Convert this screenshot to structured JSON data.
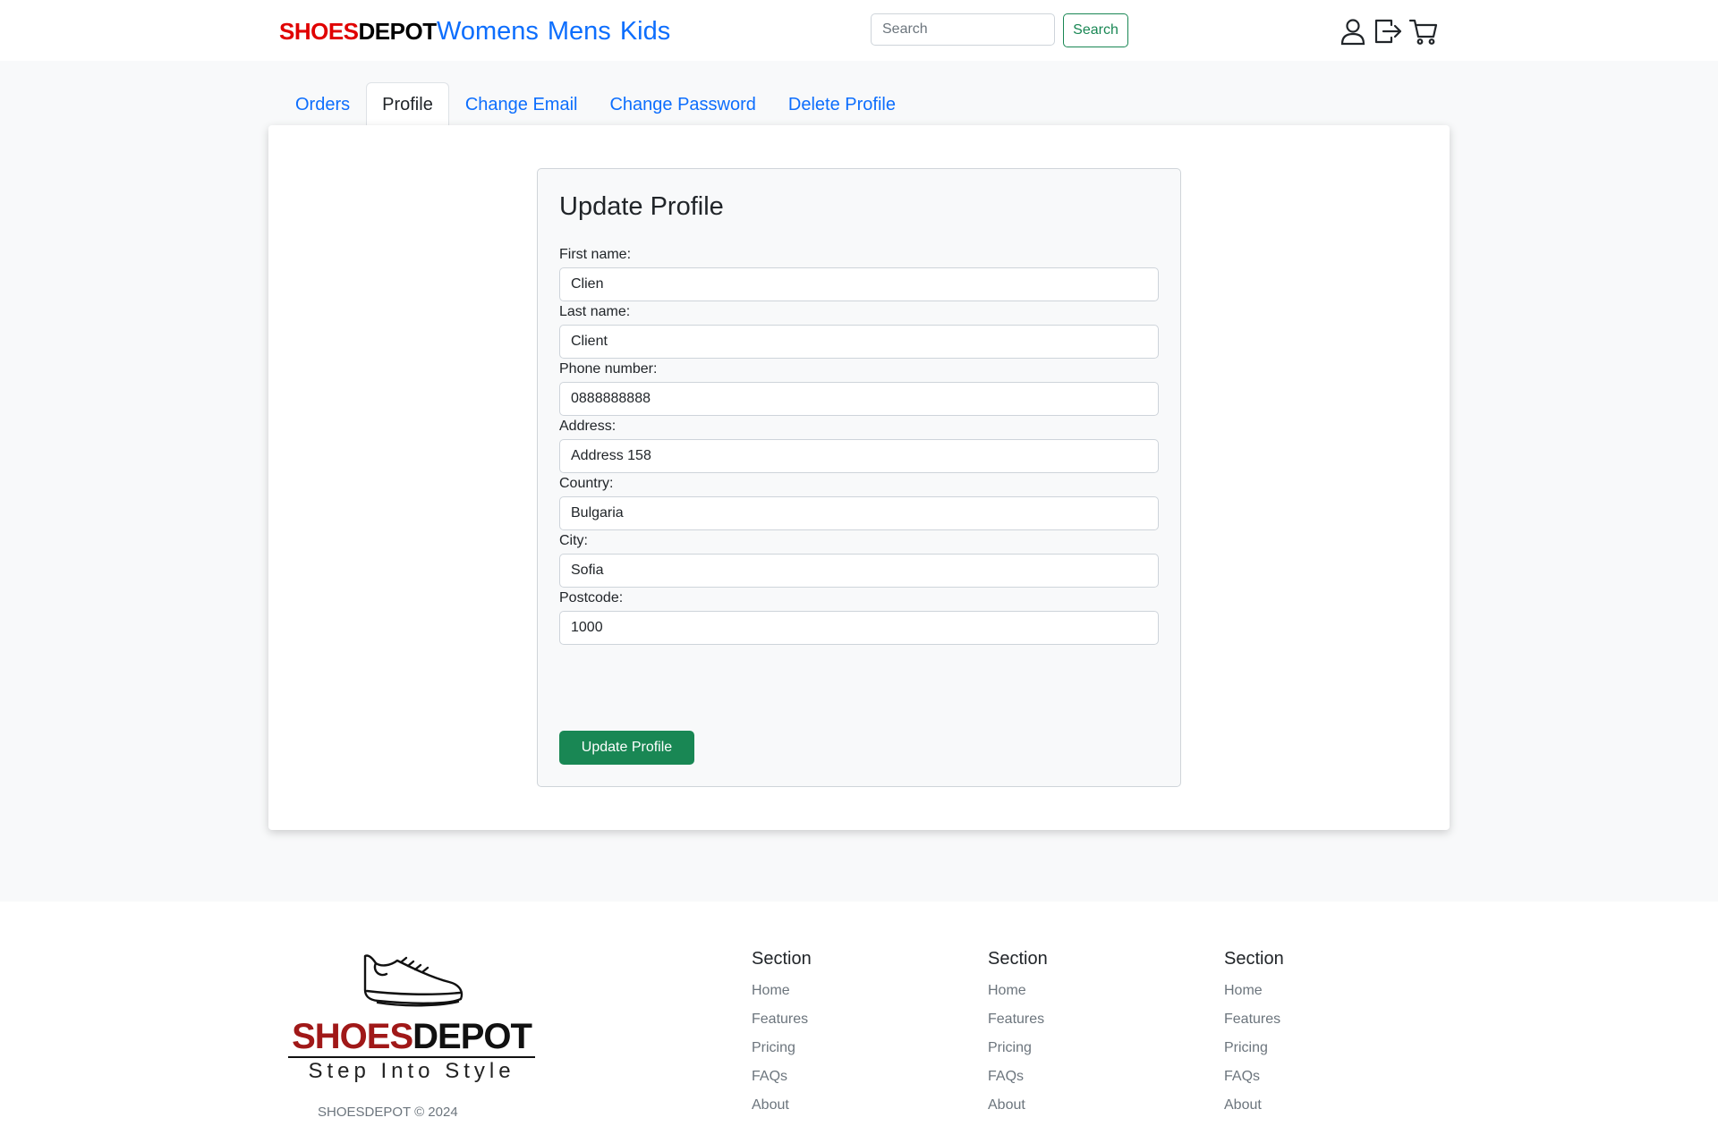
{
  "header": {
    "brand_part1": "SHOES",
    "brand_part2": "DEPOT",
    "categories": [
      "Womens",
      "Mens",
      "Kids"
    ],
    "search_placeholder": "Search",
    "search_button": "Search",
    "icons": [
      "user-icon",
      "logout-icon",
      "cart-icon"
    ]
  },
  "tabs": [
    {
      "label": "Orders",
      "active": false
    },
    {
      "label": "Profile",
      "active": true
    },
    {
      "label": "Change Email",
      "active": false
    },
    {
      "label": "Change Password",
      "active": false
    },
    {
      "label": "Delete Profile",
      "active": false
    }
  ],
  "form": {
    "title": "Update Profile",
    "fields": [
      {
        "label": "First name:",
        "value": "Clien"
      },
      {
        "label": "Last name:",
        "value": "Client"
      },
      {
        "label": "Phone number:",
        "value": "0888888888"
      },
      {
        "label": "Address:",
        "value": "Address 158"
      },
      {
        "label": "Country:",
        "value": "Bulgaria"
      },
      {
        "label": "City:",
        "value": "Sofia"
      },
      {
        "label": "Postcode:",
        "value": "1000"
      }
    ],
    "submit_label": "Update Profile"
  },
  "footer": {
    "logo_part1": "SHOES",
    "logo_part2": "DEPOT",
    "tagline": "Step Into Style",
    "copyright": "SHOESDEPOT © 2024",
    "columns": [
      {
        "title": "Section",
        "links": [
          "Home",
          "Features",
          "Pricing",
          "FAQs",
          "About"
        ]
      },
      {
        "title": "Section",
        "links": [
          "Home",
          "Features",
          "Pricing",
          "FAQs",
          "About"
        ]
      },
      {
        "title": "Section",
        "links": [
          "Home",
          "Features",
          "Pricing",
          "FAQs",
          "About"
        ]
      }
    ]
  },
  "colors": {
    "primary_link": "#0d6efd",
    "success": "#198754",
    "brand_red": "#e00000",
    "logo_red": "#a01818",
    "page_background": "#f8f9fa"
  }
}
